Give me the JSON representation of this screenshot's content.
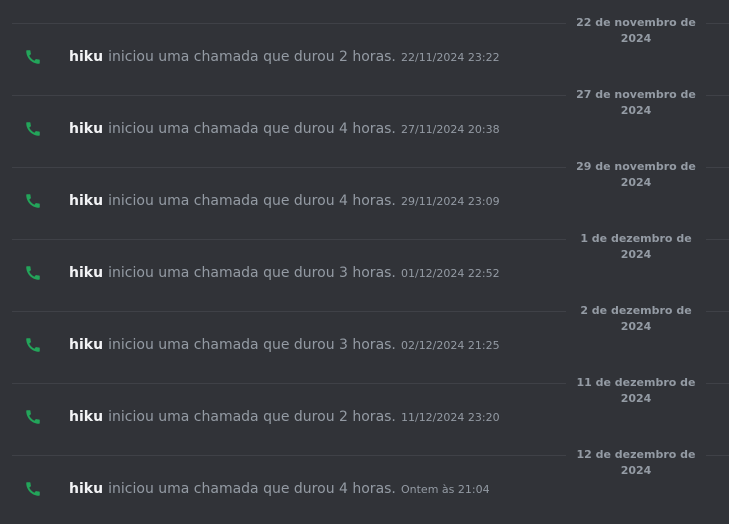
{
  "entries": [
    {
      "date": "22 de novembro de 2024",
      "author": "hiku",
      "text": "iniciou uma chamada que durou 2 horas.",
      "timestamp": "22/11/2024 23:22"
    },
    {
      "date": "27 de novembro de 2024",
      "author": "hiku",
      "text": "iniciou uma chamada que durou 4 horas.",
      "timestamp": "27/11/2024 20:38"
    },
    {
      "date": "29 de novembro de 2024",
      "author": "hiku",
      "text": "iniciou uma chamada que durou 4 horas.",
      "timestamp": "29/11/2024 23:09"
    },
    {
      "date": "1 de dezembro de 2024",
      "author": "hiku",
      "text": "iniciou uma chamada que durou 3 horas.",
      "timestamp": "01/12/2024 22:52"
    },
    {
      "date": "2 de dezembro de 2024",
      "author": "hiku",
      "text": "iniciou uma chamada que durou 3 horas.",
      "timestamp": "02/12/2024 21:25"
    },
    {
      "date": "11 de dezembro de 2024",
      "author": "hiku",
      "text": "iniciou uma chamada que durou 2 horas.",
      "timestamp": "11/12/2024 23:20"
    },
    {
      "date": "12 de dezembro de 2024",
      "author": "hiku",
      "text": "iniciou uma chamada que durou 4 horas.",
      "timestamp": "Ontem às 21:04"
    }
  ],
  "icon": "phone-icon",
  "colors": {
    "background": "#313338",
    "divider": "#3f4147",
    "muted_text": "#949ba4",
    "author_text": "#f2f3f5",
    "call_green": "#23a55a"
  }
}
